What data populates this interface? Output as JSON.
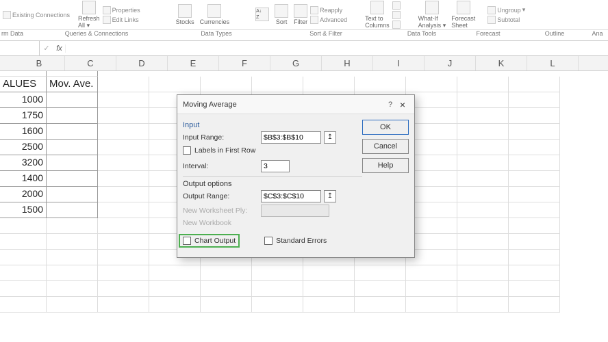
{
  "ribbon": {
    "existing": "Existing Connections",
    "refresh": "Refresh",
    "refresh_sub": "All",
    "properties": "Properties",
    "editlinks": "Edit Links",
    "stocks": "Stocks",
    "currencies": "Currencies",
    "sort": "Sort",
    "filter": "Filter",
    "reapply": "Reapply",
    "advanced": "Advanced",
    "textcols": "Text to",
    "textcols2": "Columns",
    "whatif": "What-If",
    "whatif2": "Analysis",
    "forecast": "Forecast",
    "forecast2": "Sheet",
    "ungroup": "Ungroup",
    "subtotal": "Subtotal"
  },
  "groups": {
    "data": "rm Data",
    "queries": "Queries & Connections",
    "types": "Data Types",
    "sortfilter": "Sort & Filter",
    "tools": "Data Tools",
    "forecast": "Forecast",
    "outline": "Outline",
    "ana": "Ana"
  },
  "fx": "fx",
  "cols": [
    "B",
    "C",
    "D",
    "E",
    "F",
    "G",
    "H",
    "I",
    "J",
    "K",
    "L"
  ],
  "sheet": {
    "h1": "ALUES",
    "h2": "Mov. Ave.",
    "vals": [
      "1000",
      "1750",
      "1600",
      "2500",
      "3200",
      "1400",
      "2000",
      "1500"
    ]
  },
  "dialog": {
    "title": "Moving Average",
    "help": "?",
    "close": "×",
    "ok": "OK",
    "cancel": "Cancel",
    "helpbtn": "Help",
    "input_group": "Input",
    "input_range": "Input Range:",
    "input_range_val": "$B$3:$B$10",
    "labels_first": "Labels in First Row",
    "interval": "Interval:",
    "interval_val": "3",
    "output_group": "Output options",
    "output_range": "Output Range:",
    "output_range_val": "$C$3:$C$10",
    "new_ws": "New Worksheet Ply:",
    "new_wb": "New Workbook",
    "chart_out": "Chart Output",
    "std_err": "Standard Errors"
  }
}
